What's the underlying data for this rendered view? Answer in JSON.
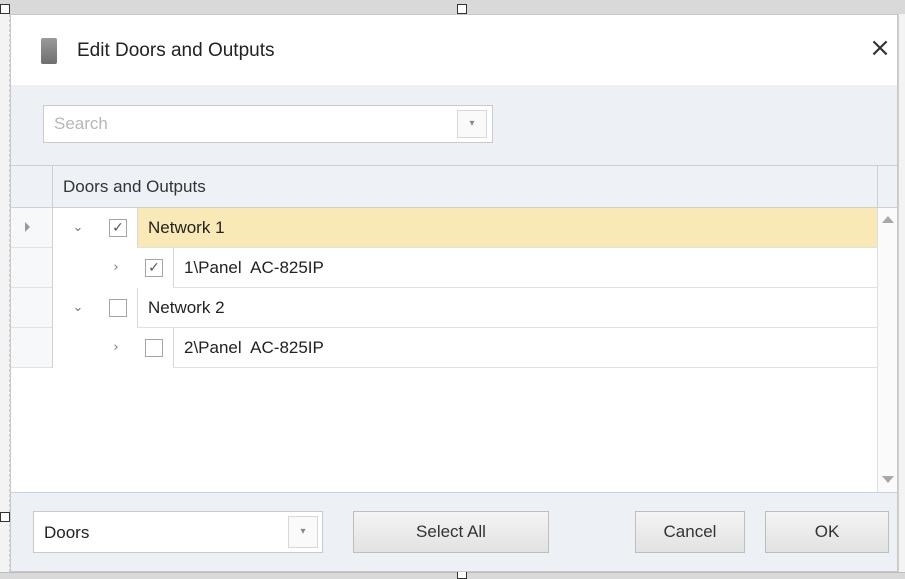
{
  "dialog": {
    "title": "Edit Doors and Outputs",
    "close_glyph": "×"
  },
  "search": {
    "placeholder": "Search",
    "value": ""
  },
  "grid": {
    "column_header": "Doors and Outputs",
    "rows": [
      {
        "label": "Network 1",
        "checked": true,
        "expanded": true,
        "level": 0,
        "selected": true
      },
      {
        "label": "1\\Panel  AC-825IP",
        "checked": true,
        "expanded": false,
        "level": 1,
        "selected": false
      },
      {
        "label": "Network 2",
        "checked": false,
        "expanded": true,
        "level": 0,
        "selected": false
      },
      {
        "label": "2\\Panel  AC-825IP",
        "checked": false,
        "expanded": false,
        "level": 1,
        "selected": false
      }
    ]
  },
  "footer": {
    "filter_value": "Doors",
    "select_all_label": "Select All",
    "cancel_label": "Cancel",
    "ok_label": "OK"
  },
  "icons": {
    "check": "✓",
    "chevron_down": "⌄",
    "chevron_right": "›",
    "dropdown": "▾"
  },
  "colors": {
    "selected_row": "#f9e9b7",
    "panel_bg": "#edf1f6"
  }
}
